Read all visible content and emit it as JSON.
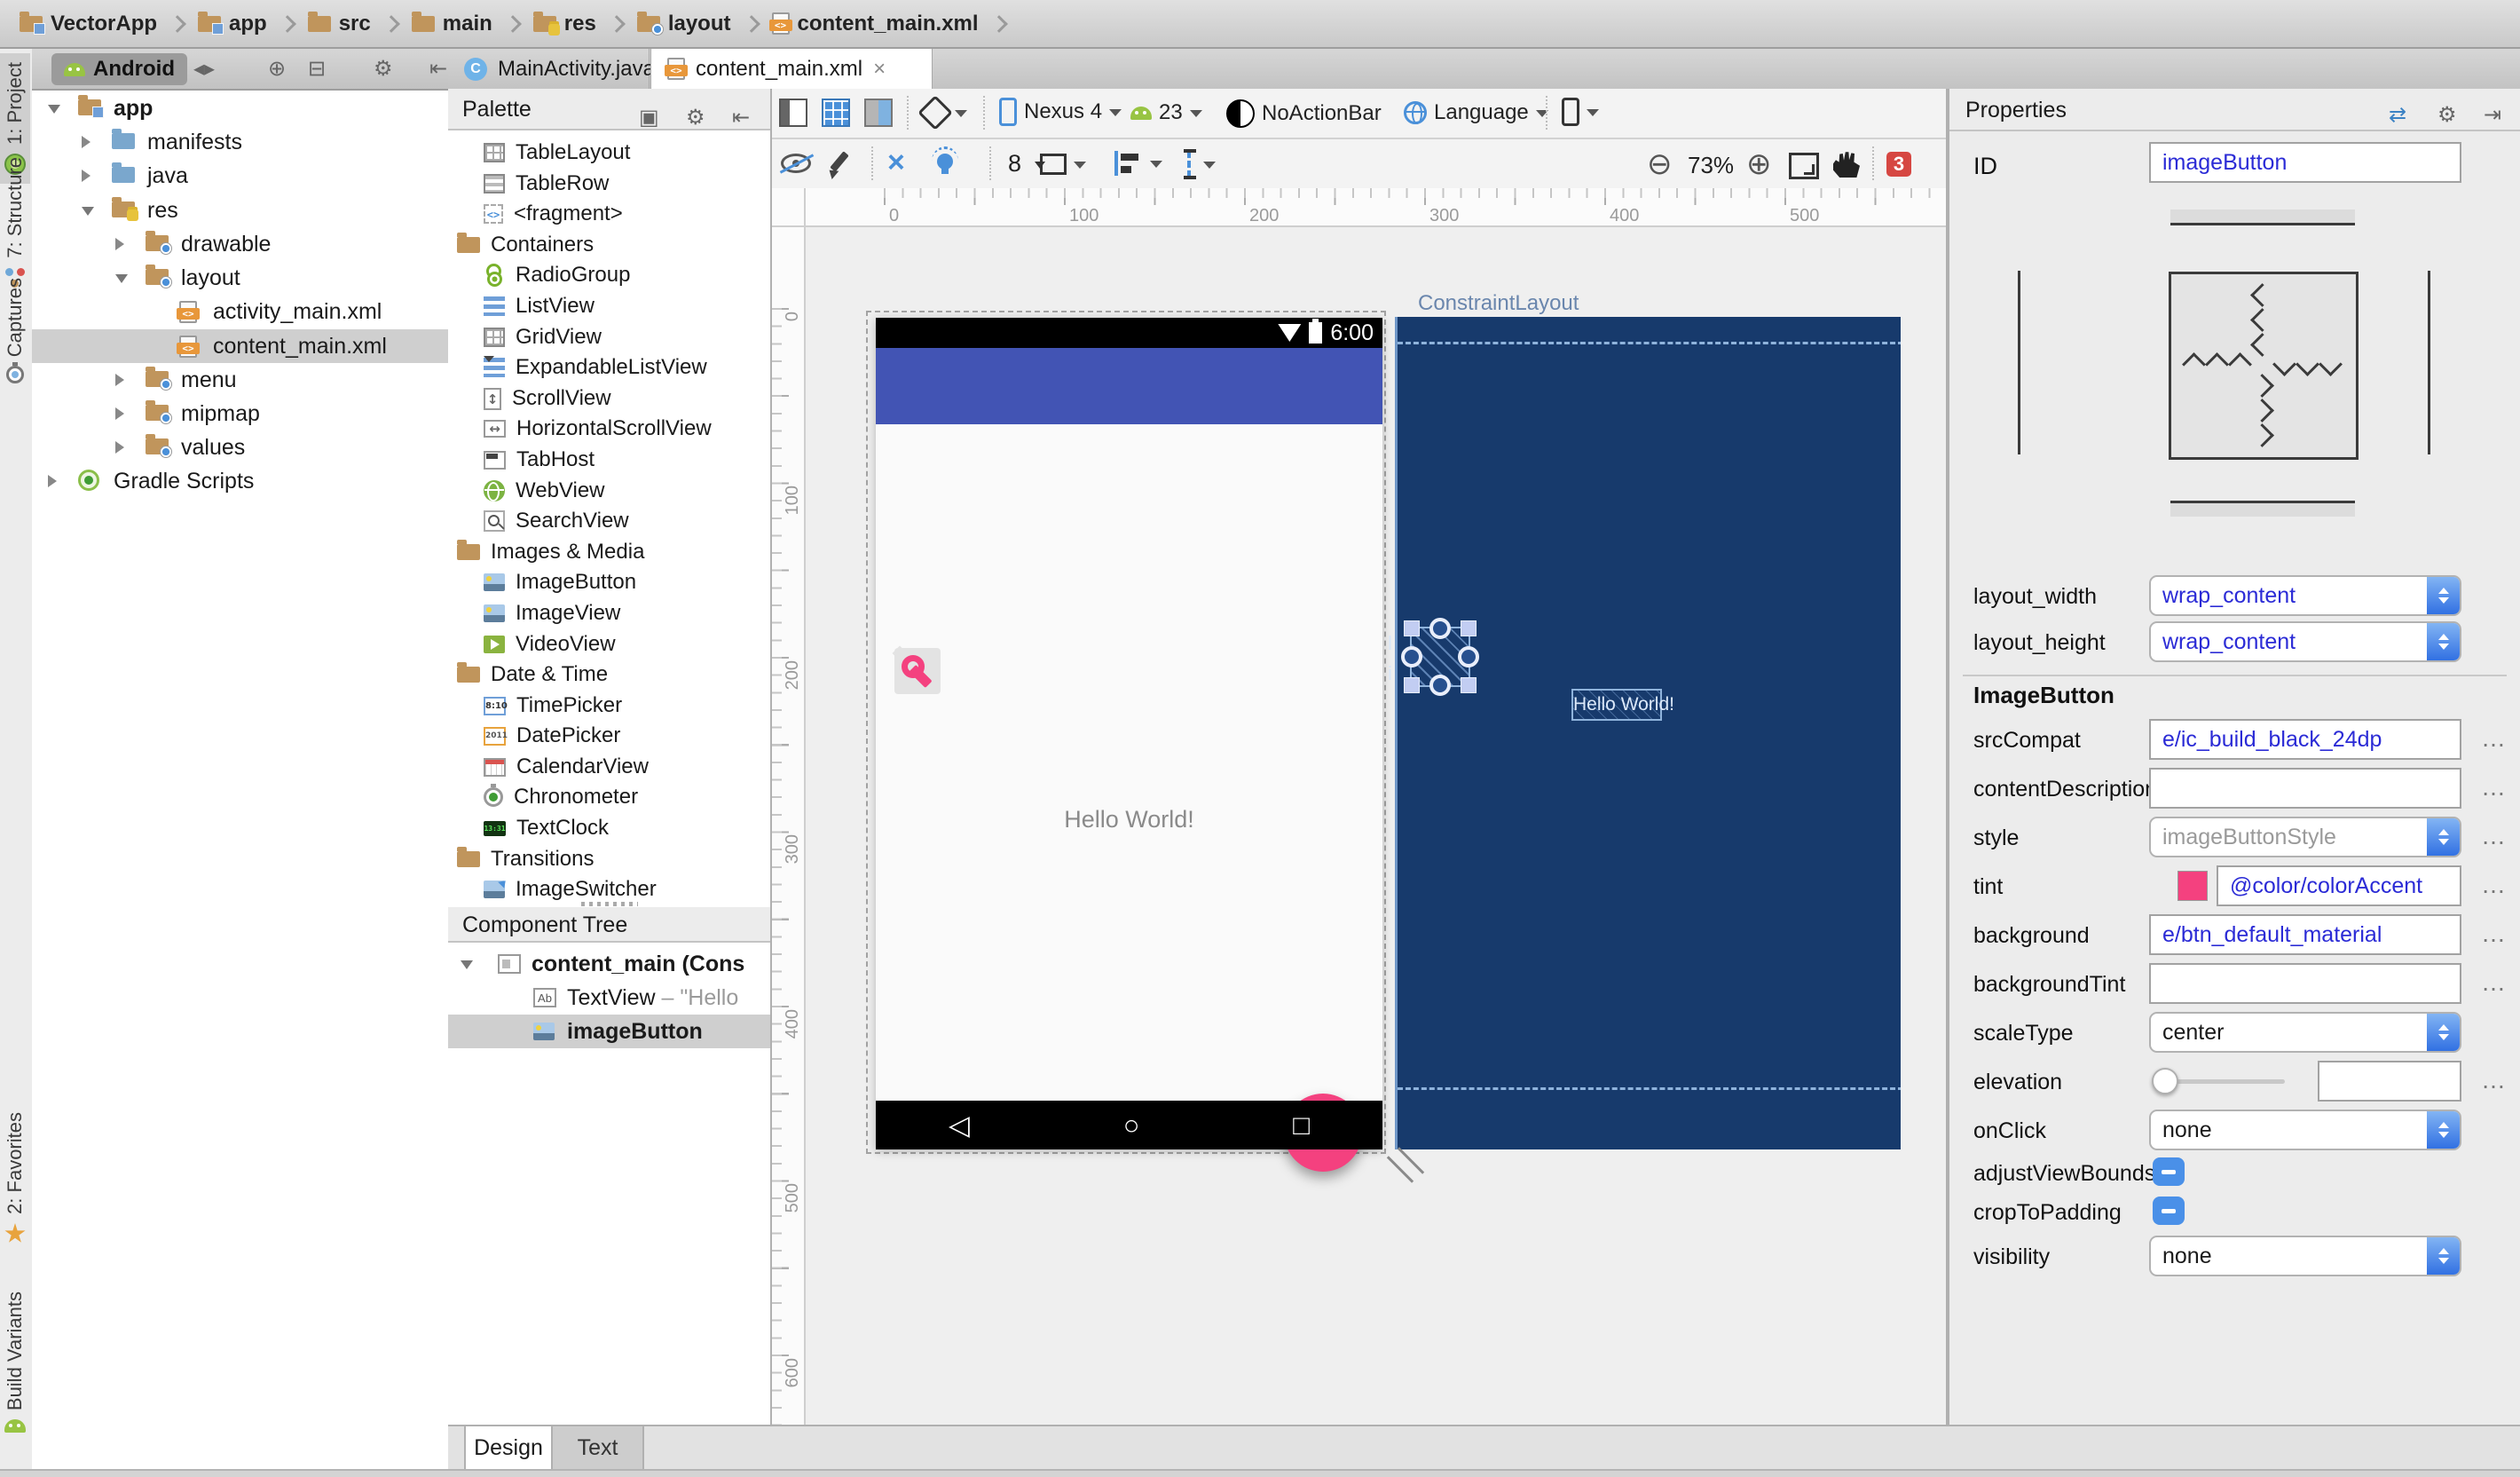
{
  "breadcrumb": {
    "items": [
      {
        "label": "VectorApp",
        "icon": "folder-project"
      },
      {
        "label": "app",
        "icon": "folder-project"
      },
      {
        "label": "src",
        "icon": "folder"
      },
      {
        "label": "main",
        "icon": "folder"
      },
      {
        "label": "res",
        "icon": "folder-res"
      },
      {
        "label": "layout",
        "icon": "folder-dot"
      },
      {
        "label": "content_main.xml",
        "icon": "xml-file"
      }
    ]
  },
  "tool_strip": {
    "top": [
      {
        "label": "1: Project",
        "icon": "android-project"
      },
      {
        "label": "7: Structure",
        "icon": "structure"
      },
      {
        "label": "Captures",
        "icon": "stopwatch"
      }
    ],
    "bottom": [
      {
        "label": "2: Favorites",
        "icon": "star"
      },
      {
        "label": "Build Variants",
        "icon": "android-head"
      }
    ]
  },
  "project_panel": {
    "mode_button": "Android",
    "tree": [
      {
        "label": "app",
        "icon": "folder-project"
      },
      {
        "label": "manifests",
        "icon": "folder-blue"
      },
      {
        "label": "java",
        "icon": "folder-blue"
      },
      {
        "label": "res",
        "icon": "folder-res"
      },
      {
        "label": "drawable",
        "icon": "folder-dot"
      },
      {
        "label": "layout",
        "icon": "folder-dot"
      },
      {
        "label": "activity_main.xml",
        "icon": "xml-file"
      },
      {
        "label": "content_main.xml",
        "icon": "xml-file"
      },
      {
        "label": "menu",
        "icon": "folder-dot"
      },
      {
        "label": "mipmap",
        "icon": "folder-dot"
      },
      {
        "label": "values",
        "icon": "folder-dot"
      },
      {
        "label": "Gradle Scripts",
        "icon": "gradle"
      }
    ]
  },
  "editor_tabs": [
    {
      "label": "MainActivity.java",
      "icon": "java-class",
      "close": "×"
    },
    {
      "label": "content_main.xml",
      "icon": "xml-file",
      "close": "×"
    }
  ],
  "palette": {
    "title": "Palette",
    "items": [
      {
        "label": "TableLayout",
        "icon": "table"
      },
      {
        "label": "TableRow",
        "icon": "tablerow"
      },
      {
        "label": "<fragment>",
        "icon": "fragment"
      },
      {
        "label": "Containers",
        "icon": "folder"
      },
      {
        "label": "RadioGroup",
        "icon": "radiogroup"
      },
      {
        "label": "ListView",
        "icon": "listview"
      },
      {
        "label": "GridView",
        "icon": "gridview"
      },
      {
        "label": "ExpandableListView",
        "icon": "expandable"
      },
      {
        "label": "ScrollView",
        "icon": "scrollv"
      },
      {
        "label": "HorizontalScrollView",
        "icon": "scrollh"
      },
      {
        "label": "TabHost",
        "icon": "tabhost"
      },
      {
        "label": "WebView",
        "icon": "webview"
      },
      {
        "label": "SearchView",
        "icon": "searchview"
      },
      {
        "label": "Images & Media",
        "icon": "folder"
      },
      {
        "label": "ImageButton",
        "icon": "image"
      },
      {
        "label": "ImageView",
        "icon": "image"
      },
      {
        "label": "VideoView",
        "icon": "video"
      },
      {
        "label": "Date & Time",
        "icon": "folder"
      },
      {
        "label": "TimePicker",
        "icon": "time"
      },
      {
        "label": "DatePicker",
        "icon": "date"
      },
      {
        "label": "CalendarView",
        "icon": "calendar"
      },
      {
        "label": "Chronometer",
        "icon": "chrono"
      },
      {
        "label": "TextClock",
        "icon": "clock"
      },
      {
        "label": "Transitions",
        "icon": "folder"
      },
      {
        "label": "ImageSwitcher",
        "icon": "imageswitch"
      }
    ]
  },
  "component_tree": {
    "title": "Component Tree",
    "items": [
      {
        "label": "content_main (Cons",
        "icon": "constraint-layout"
      },
      {
        "label": "TextView",
        "suffix": " – \"Hello",
        "icon": "textview"
      },
      {
        "label": "imageButton",
        "icon": "image"
      }
    ]
  },
  "design_toolbar": {
    "device_label": "Nexus 4",
    "api_label": "23",
    "theme_label": "NoActionBar",
    "locale_label": "Language",
    "margin_value": "8",
    "zoom_value": "73%",
    "error_count": "3"
  },
  "canvas": {
    "h_ruler_labels": [
      "0",
      "100",
      "200",
      "300",
      "400",
      "500"
    ],
    "v_ruler_labels": [
      "0",
      "100",
      "200",
      "300",
      "400",
      "500",
      "600"
    ],
    "design": {
      "status_time": "6:00",
      "hello_text": "Hello World!"
    },
    "blueprint": {
      "root_label": "ConstraintLayout",
      "hello_text": "Hello World!",
      "clip_l": "l",
      "clip_i": "i"
    }
  },
  "properties": {
    "title": "Properties",
    "id_label": "ID",
    "id_value": "imageButton",
    "layout_width_label": "layout_width",
    "layout_width_value": "wrap_content",
    "layout_height_label": "layout_height",
    "layout_height_value": "wrap_content",
    "section_title": "ImageButton",
    "srcCompat_label": "srcCompat",
    "srcCompat_value": "e/ic_build_black_24dp",
    "contentDescription_label": "contentDescription",
    "contentDescription_value": "",
    "style_label": "style",
    "style_value": "imageButtonStyle",
    "tint_label": "tint",
    "tint_value": "@color/colorAccent",
    "tint_swatch": "#F4417F",
    "background_label": "background",
    "background_value": "e/btn_default_material",
    "backgroundTint_label": "backgroundTint",
    "backgroundTint_value": "",
    "scaleType_label": "scaleType",
    "scaleType_value": "center",
    "elevation_label": "elevation",
    "elevation_value": "",
    "onClick_label": "onClick",
    "onClick_value": "none",
    "adjustViewBounds_label": "adjustViewBounds",
    "cropToPadding_label": "cropToPadding",
    "visibility_label": "visibility",
    "visibility_value": "none"
  },
  "bottom_tabs": [
    {
      "label": "Design"
    },
    {
      "label": "Text"
    }
  ],
  "icons": {
    "gear": "⚙",
    "collapse_left": "⇤",
    "swap_panels": "⇄",
    "dock": "⇥",
    "copy": "▣",
    "back_forward": "◂▸",
    "locate": "⊕",
    "collapse_all": "⊟",
    "zoom_out": "⊖",
    "zoom_in": "⊕",
    "nav_back": "◁",
    "nav_home": "○",
    "nav_recents": "□",
    "more": "…"
  },
  "colors": {
    "accent_pink": "#F4417F",
    "primary_indigo": "#4254B4",
    "blueprint_navy": "#173A6C",
    "error_red": "#D64742",
    "blueprint_line": "#8FB3DC"
  }
}
